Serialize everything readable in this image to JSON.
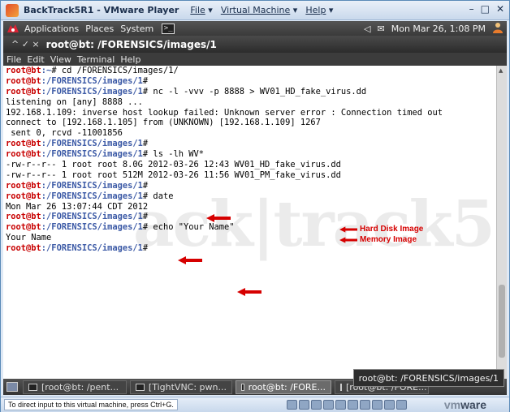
{
  "vm": {
    "title": "BackTrack5R1 - VMware Player",
    "menus": [
      "File",
      "Virtual Machine",
      "Help"
    ],
    "window_controls": [
      "–",
      "□",
      "✕"
    ]
  },
  "gnome_panel": {
    "applications": "Applications",
    "places": "Places",
    "system": "System",
    "datetime": "Mon Mar 26,  1:08 PM"
  },
  "terminal": {
    "title": "root@bt: /FORENSICS/images/1",
    "title_controls": "^  ✓  ×",
    "menu": [
      "File",
      "Edit",
      "View",
      "Terminal",
      "Help"
    ],
    "prompt_user": "root@bt",
    "lines": [
      {
        "type": "prompt",
        "path": ":~",
        "cmd": "# cd /FORENSICS/images/1/"
      },
      {
        "type": "prompt",
        "path": ":/FORENSICS/images/1",
        "cmd": "#"
      },
      {
        "type": "prompt",
        "path": ":/FORENSICS/images/1",
        "cmd": "# nc -l -vvv -p 8888 > WV01_HD_fake_virus.dd"
      },
      {
        "type": "out",
        "text": "listening on [any] 8888 ..."
      },
      {
        "type": "out",
        "text": "192.168.1.109: inverse host lookup failed: Unknown server error : Connection timed out"
      },
      {
        "type": "out",
        "text": "connect to [192.168.1.105] from (UNKNOWN) [192.168.1.109] 1267"
      },
      {
        "type": "out",
        "text": " sent 0, rcvd -11001856"
      },
      {
        "type": "prompt",
        "path": ":/FORENSICS/images/1",
        "cmd": "#"
      },
      {
        "type": "prompt",
        "path": ":/FORENSICS/images/1",
        "cmd": "# ls -lh WV*"
      },
      {
        "type": "out",
        "text": "-rw-r--r-- 1 root root 8.0G 2012-03-26 12:43 WV01_HD_fake_virus.dd"
      },
      {
        "type": "out",
        "text": "-rw-r--r-- 1 root root 512M 2012-03-26 11:56 WV01_PM_fake_virus.dd"
      },
      {
        "type": "prompt",
        "path": ":/FORENSICS/images/1",
        "cmd": "#"
      },
      {
        "type": "prompt",
        "path": ":/FORENSICS/images/1",
        "cmd": "# date"
      },
      {
        "type": "out",
        "text": "Mon Mar 26 13:07:44 CDT 2012"
      },
      {
        "type": "prompt",
        "path": ":/FORENSICS/images/1",
        "cmd": "#"
      },
      {
        "type": "prompt",
        "path": ":/FORENSICS/images/1",
        "cmd": "# echo \"Your Name\""
      },
      {
        "type": "out",
        "text": "Your Name"
      },
      {
        "type": "prompt",
        "path": ":/FORENSICS/images/1",
        "cmd": "#"
      }
    ],
    "watermark": "ack|track5",
    "annotations": {
      "hd_label": "Hard Disk Image",
      "mem_label": "Memory Image"
    }
  },
  "taskbar": {
    "items": [
      {
        "label": "[root@bt: /pent...",
        "active": false
      },
      {
        "label": "[TightVNC: pwn...",
        "active": false
      },
      {
        "label": "root@bt: /FORE...",
        "active": true
      },
      {
        "label": "[root@bt: /FORE...",
        "active": false
      }
    ],
    "tooltip": "root@bt: /FORENSICS/images/1"
  },
  "vm_status": {
    "hint": "To direct input to this virtual machine, press Ctrl+G.",
    "logo_vm": "vm",
    "logo_ware": "ware"
  },
  "colors": {
    "prompt": "#c80000",
    "path": "#3c5aa6",
    "annotation": "#d60000"
  }
}
